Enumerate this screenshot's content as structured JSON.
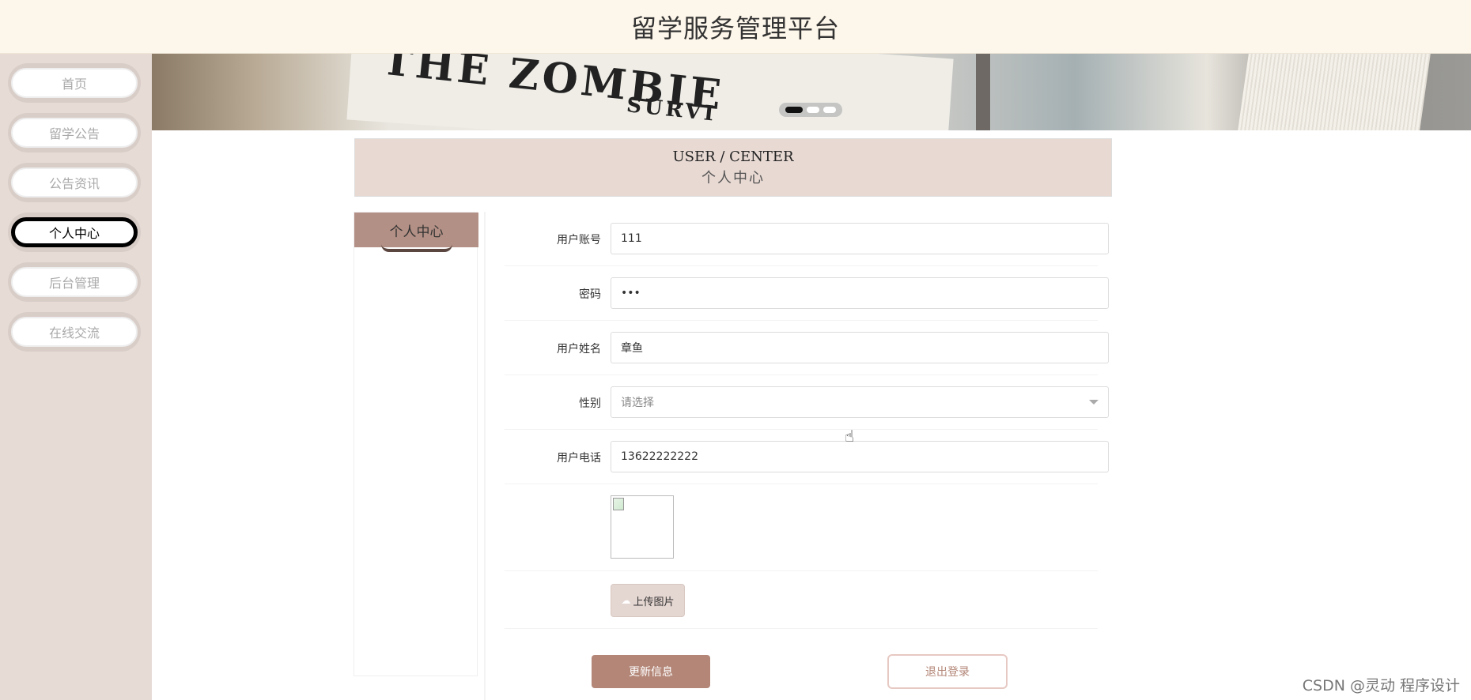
{
  "header": {
    "title": "留学服务管理平台"
  },
  "sidebar": {
    "items": [
      {
        "label": "首页",
        "active": false
      },
      {
        "label": "留学公告",
        "active": false
      },
      {
        "label": "公告资讯",
        "active": false
      },
      {
        "label": "个人中心",
        "active": true
      },
      {
        "label": "后台管理",
        "active": false
      },
      {
        "label": "在线交流",
        "active": false
      }
    ]
  },
  "banner": {
    "text_main": "THE ZOMBIE",
    "text_sub": "SURVI",
    "dots": 3,
    "active_dot": 1
  },
  "user_center": {
    "title_en": "USER / CENTER",
    "title_cn": "个人中心",
    "side_tab": "个人中心"
  },
  "form": {
    "fields": [
      {
        "label": "用户账号",
        "value": "111"
      },
      {
        "label": "密码",
        "value": "•••"
      },
      {
        "label": "用户姓名",
        "value": "章鱼"
      },
      {
        "label": "性别",
        "placeholder": "请选择"
      },
      {
        "label": "用户电话",
        "value": "13622222222"
      }
    ],
    "upload_label": "上传图片",
    "update_label": "更新信息",
    "logout_label": "退出登录"
  },
  "icons": {
    "upload": "cloud-upload-icon",
    "cursor": "hand-pointer-icon",
    "select_arrow": "caret-down-icon"
  },
  "colors": {
    "accent": "#b38677",
    "header_bg": "#fdf6ea",
    "sidebar_bg": "#e6dbd5"
  },
  "watermark": "CSDN @灵动 程序设计"
}
